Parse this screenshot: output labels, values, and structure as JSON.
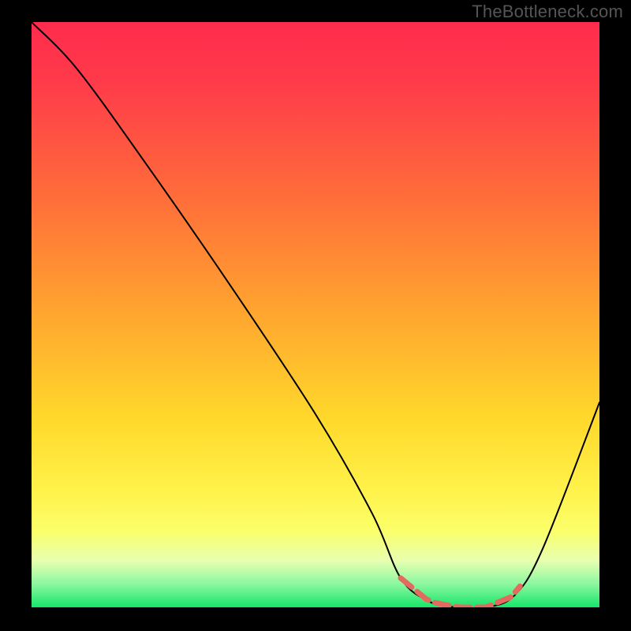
{
  "watermark": "TheBottleneck.com",
  "chart_data": {
    "type": "line",
    "title": "",
    "xlabel": "",
    "ylabel": "",
    "xlim": [
      0,
      100
    ],
    "ylim": [
      0,
      100
    ],
    "series": [
      {
        "name": "bottleneck-curve",
        "x": [
          0,
          8,
          20,
          35,
          50,
          60,
          65,
          70,
          75,
          80,
          85,
          90,
          100
        ],
        "y": [
          100,
          92,
          76,
          55,
          33,
          16,
          5,
          1,
          0,
          0,
          2,
          10,
          35
        ]
      }
    ],
    "highlight_segment": {
      "name": "optimal-range",
      "x_start": 65,
      "x_end": 86,
      "y_approx": 0
    },
    "background_gradient": {
      "top": "#ff2c4d",
      "mid": "#ffd92b",
      "bottom": "#17e66a"
    }
  }
}
